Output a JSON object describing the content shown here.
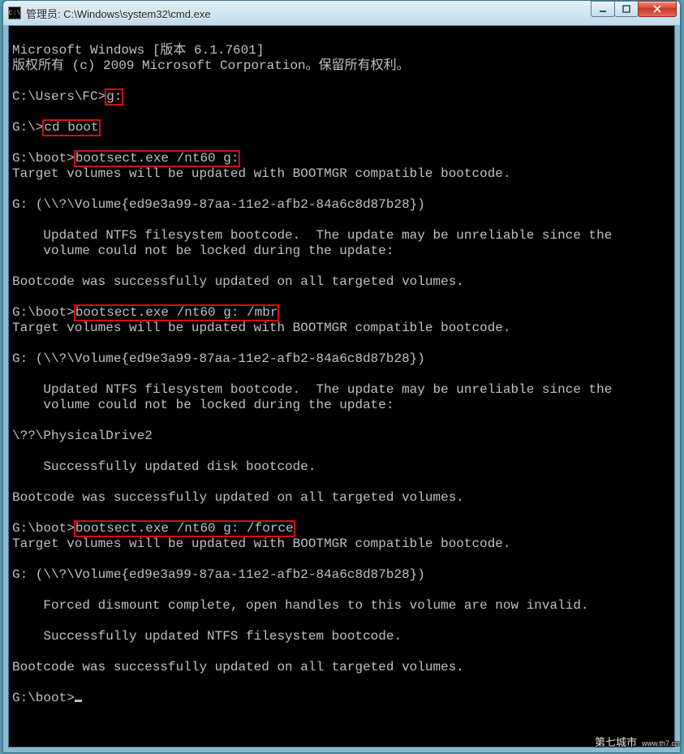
{
  "window": {
    "title": "管理员: C:\\Windows\\system32\\cmd.exe",
    "icon_glyph": "C:\\"
  },
  "buttons": {
    "minimize_label": "Minimize",
    "maximize_label": "Maximize",
    "close_label": "Close"
  },
  "header_lines": {
    "l1": "Microsoft Windows [版本 6.1.7601]",
    "l2": "版权所有 (c) 2009 Microsoft Corporation。保留所有权利。"
  },
  "blocks": [
    {
      "prompt": "C:\\Users\\FC>",
      "cmd": "g:"
    },
    {
      "prompt": "G:\\>",
      "cmd": "cd boot"
    },
    {
      "prompt": "G:\\boot>",
      "cmd": "bootsect.exe /nt60 g:"
    }
  ],
  "out1": {
    "a": "Target volumes will be updated with BOOTMGR compatible bootcode.",
    "b": "G: (\\\\?\\Volume{ed9e3a99-87aa-11e2-afb2-84a6c8d87b28})",
    "c": "    Updated NTFS filesystem bootcode.  The update may be unreliable since the",
    "d": "    volume could not be locked during the update:",
    "e": "Bootcode was successfully updated on all targeted volumes."
  },
  "cmd2": {
    "prompt": "G:\\boot>",
    "cmd": "bootsect.exe /nt60 g: /mbr"
  },
  "out2": {
    "a": "Target volumes will be updated with BOOTMGR compatible bootcode.",
    "b": "G: (\\\\?\\Volume{ed9e3a99-87aa-11e2-afb2-84a6c8d87b28})",
    "c": "    Updated NTFS filesystem bootcode.  The update may be unreliable since the",
    "d": "    volume could not be locked during the update:",
    "e": "\\??\\PhysicalDrive2",
    "f": "    Successfully updated disk bootcode.",
    "g": "Bootcode was successfully updated on all targeted volumes."
  },
  "cmd3": {
    "prompt": "G:\\boot>",
    "cmd": "bootsect.exe /nt60 g: /force"
  },
  "out3": {
    "a": "Target volumes will be updated with BOOTMGR compatible bootcode.",
    "b": "G: (\\\\?\\Volume{ed9e3a99-87aa-11e2-afb2-84a6c8d87b28})",
    "c": "    Forced dismount complete, open handles to this volume are now invalid.",
    "d": "    Successfully updated NTFS filesystem bootcode.",
    "e": "Bootcode was successfully updated on all targeted volumes."
  },
  "final_prompt": "G:\\boot>",
  "watermark": {
    "main": "第七城市",
    "sub": "www.th7.cn"
  }
}
